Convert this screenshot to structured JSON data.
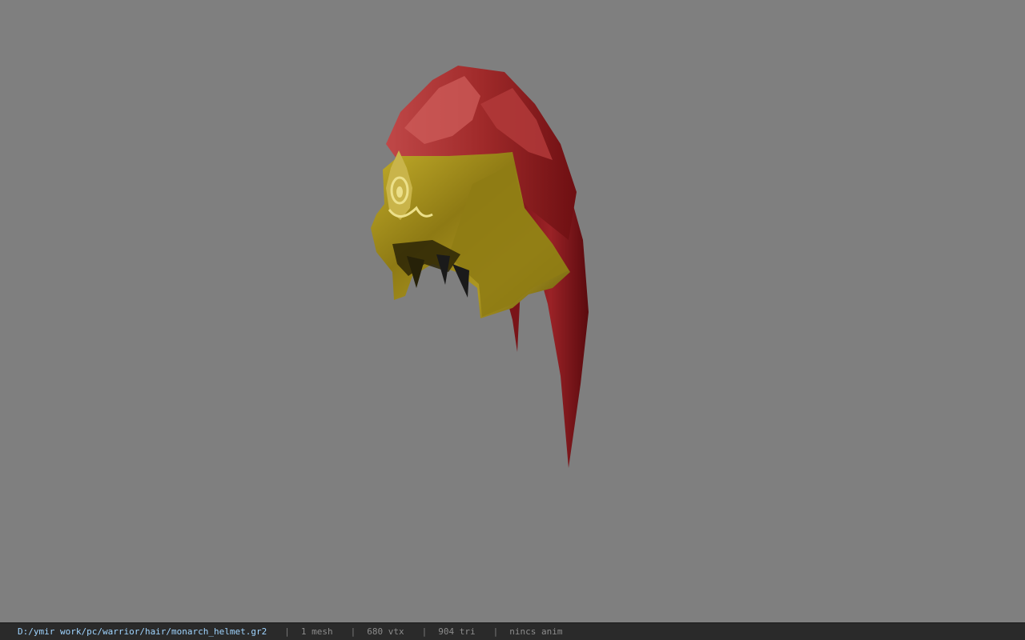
{
  "viewport": {
    "background": "#7f7f7f",
    "model_name": "monarch_helmet"
  },
  "statusbar": {
    "path": "D:/ymir work/pc/warrior/hair/monarch_helmet.gr2",
    "separator": "|",
    "mesh": "1 mesh",
    "vertices": "680 vtx",
    "triangles": "904 tri",
    "anim": "nincs anim",
    "path_color": "#9fd4ff",
    "text_color": "#8c8c8c"
  }
}
